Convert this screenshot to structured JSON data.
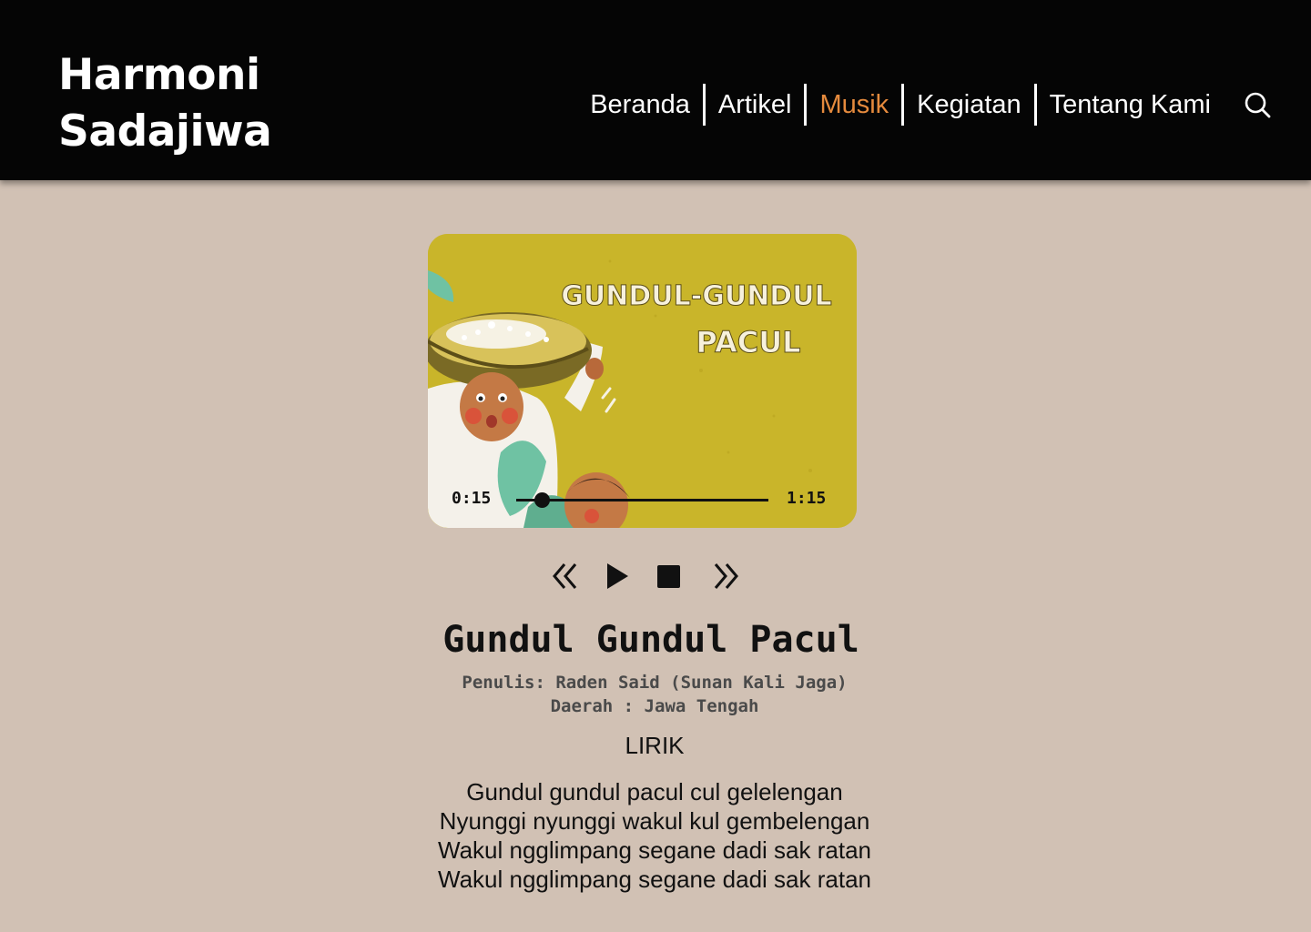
{
  "site": {
    "logo_line1": "Harmoni",
    "logo_line2": "Sadajiwa"
  },
  "nav": {
    "items": [
      {
        "label": "Beranda",
        "active": false
      },
      {
        "label": "Artikel",
        "active": false
      },
      {
        "label": "Musik",
        "active": true
      },
      {
        "label": "Kegiatan",
        "active": false
      },
      {
        "label": "Tentang Kami",
        "active": false
      }
    ],
    "search_icon": "search-icon"
  },
  "colors": {
    "header_bg": "#050505",
    "page_bg": "#d1c1b4",
    "active_nav": "#e58a3d",
    "cover_bg": "#c9b52a"
  },
  "player": {
    "cover_title_line1": "GUNDUL-GUNDUL",
    "cover_title_line2": "PACUL",
    "current_time": "0:15",
    "total_time": "1:15",
    "progress": 0.1,
    "controls": [
      "rewind-icon",
      "play-icon",
      "stop-icon",
      "fast-forward-icon"
    ]
  },
  "song": {
    "title": "Gundul Gundul Pacul",
    "writer": "Penulis: Raden Said (Sunan Kali Jaga)",
    "region": "Daerah : Jawa Tengah",
    "lyrics_heading": "LIRIK",
    "lyrics": [
      "Gundul gundul pacul cul gelelengan",
      "Nyunggi nyunggi wakul kul gembelengan",
      "Wakul ngglimpang segane dadi sak ratan",
      "Wakul ngglimpang segane dadi sak ratan"
    ]
  }
}
